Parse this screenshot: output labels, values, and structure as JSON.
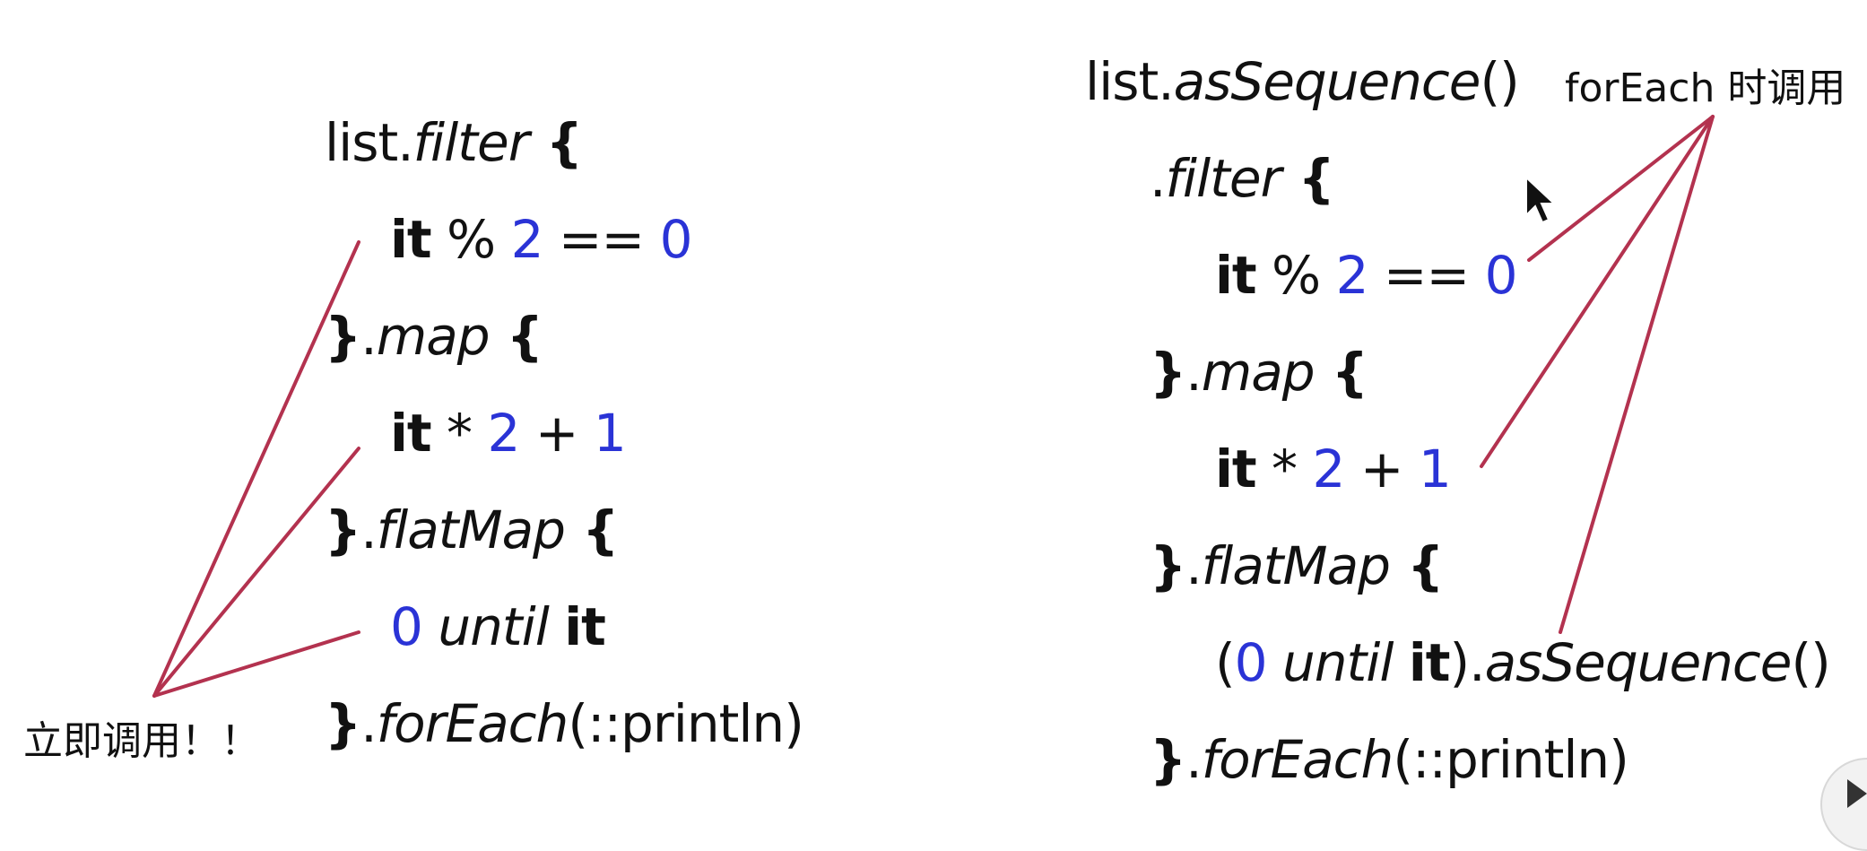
{
  "left_code": {
    "line1": {
      "recv": "list.",
      "fn": "filter",
      "brace": " {"
    },
    "line2": {
      "it": "it",
      "op1": " % ",
      "n1": "2",
      "op2": " == ",
      "n2": "0"
    },
    "line3": {
      "close": "}",
      "dot": ".",
      "fn": "map",
      "brace": " {"
    },
    "line4": {
      "it": "it",
      "op1": " * ",
      "n1": "2",
      "op2": " + ",
      "n2": "1"
    },
    "line5": {
      "close": "}",
      "dot": ".",
      "fn": "flatMap",
      "brace": " {"
    },
    "line6": {
      "n1": "0",
      "fn": " until ",
      "it": "it"
    },
    "line7": {
      "close": "}",
      "dot": ".",
      "fn": "forEach",
      "args": "(::println)"
    }
  },
  "right_code": {
    "line1": {
      "recv": "list.",
      "fn": "asSequence",
      "args": "()"
    },
    "line2": {
      "dot": ".",
      "fn": "filter",
      "brace": " {"
    },
    "line3": {
      "it": "it",
      "op1": " % ",
      "n1": "2",
      "op2": " == ",
      "n2": "0"
    },
    "line4": {
      "close": "}",
      "dot": ".",
      "fn": "map",
      "brace": " {"
    },
    "line5": {
      "it": "it",
      "op1": " * ",
      "n1": "2",
      "op2": " + ",
      "n2": "1"
    },
    "line6": {
      "close": "}",
      "dot": ".",
      "fn": "flatMap",
      "brace": " {"
    },
    "line7": {
      "open": "(",
      "n1": "0",
      "fn": " until ",
      "it": "it",
      "close": ").",
      "fn2": "asSequence",
      "args": "()"
    },
    "line8": {
      "close": "}",
      "dot": ".",
      "fn": "forEach",
      "args": "(::println)"
    }
  },
  "annotations": {
    "left_note": "立即调用！！",
    "right_note": "forEach 时调用"
  },
  "colors": {
    "number": "#2a33d6",
    "annotation_line": "#b3324f",
    "text": "#111111"
  },
  "icons": [
    "mouse-cursor-icon",
    "play-icon"
  ]
}
